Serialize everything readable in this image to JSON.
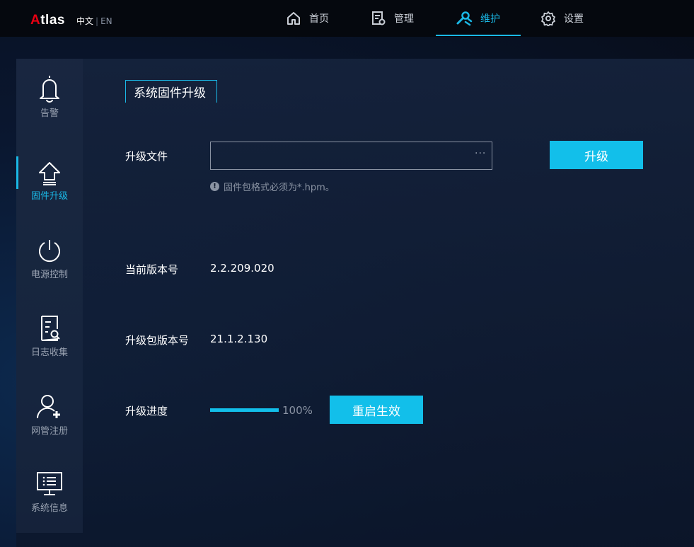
{
  "header": {
    "logo_accent": "A",
    "logo_rest": "tlas",
    "lang_current": "中文",
    "lang_sep": "|",
    "lang_other": "EN",
    "nav": [
      {
        "label": "首页",
        "icon": "home-icon"
      },
      {
        "label": "管理",
        "icon": "manage-icon"
      },
      {
        "label": "维护",
        "icon": "wrench-icon",
        "active": true
      },
      {
        "label": "设置",
        "icon": "gear-icon"
      }
    ]
  },
  "sidebar": {
    "items": [
      {
        "label": "告警",
        "icon": "bell-icon"
      },
      {
        "label": "固件升级",
        "icon": "upgrade-icon",
        "active": true
      },
      {
        "label": "电源控制",
        "icon": "power-icon"
      },
      {
        "label": "日志收集",
        "icon": "log-search-icon"
      },
      {
        "label": "网管注册",
        "icon": "user-add-icon"
      },
      {
        "label": "系统信息",
        "icon": "monitor-icon"
      }
    ]
  },
  "main": {
    "tab_title": "系统固件升级",
    "upgrade_file_label": "升级文件",
    "file_value": "",
    "file_browse": "···",
    "file_hint": "固件包格式必须为*.hpm。",
    "upgrade_button": "升级",
    "current_version_label": "当前版本号",
    "current_version": "2.2.209.020",
    "package_version_label": "升级包版本号",
    "package_version": "21.1.2.130",
    "progress_label": "升级进度",
    "progress_value": 1.0,
    "progress_text": "100%",
    "restart_button": "重启生效"
  },
  "colors": {
    "accent": "#12bfea",
    "logo_red": "#e60012",
    "header_bg": "#05080e"
  }
}
